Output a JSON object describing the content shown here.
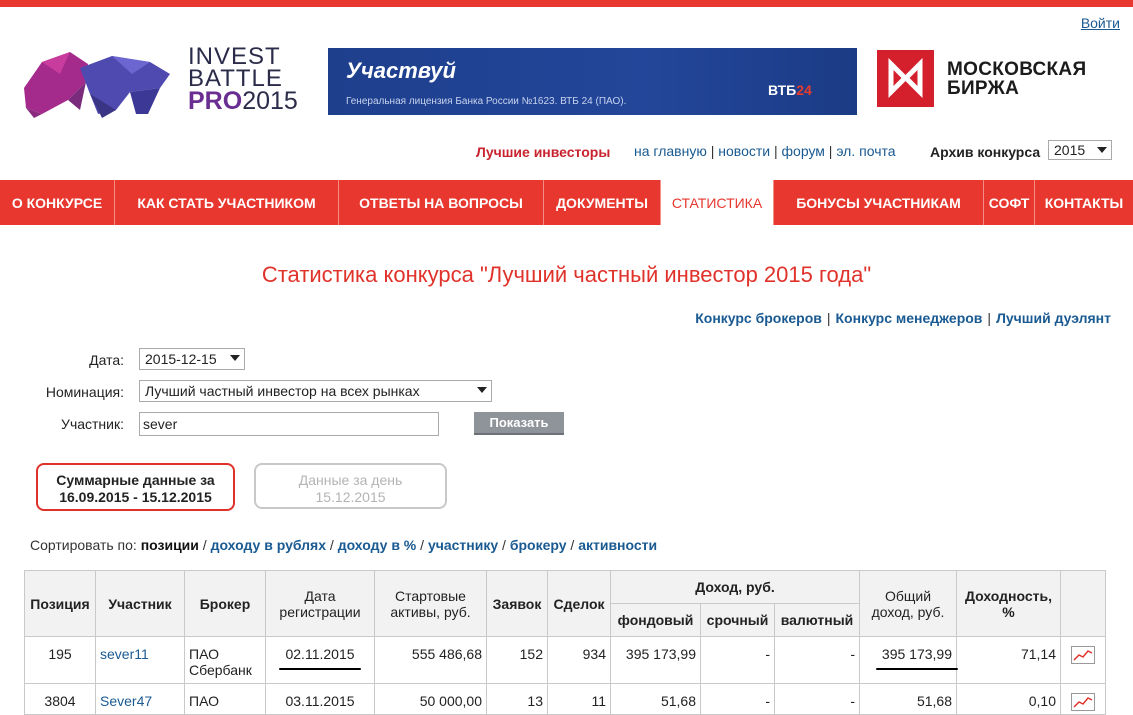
{
  "header": {
    "login": "Войти",
    "logo": {
      "line1": "INVEST",
      "line2": "BATTLE",
      "line3_brand": "PRO",
      "line3_year": "2015"
    },
    "banner": {
      "title": "Участвуй",
      "subtitle": "Генеральная лицензия Банка России №1623. ВТБ 24 (ПАО).",
      "brand_a": "ВТБ",
      "brand_b": "24"
    },
    "moex": {
      "line1": "МОСКОВСКАЯ",
      "line2": "БИРЖА"
    }
  },
  "subnav": {
    "best_investors": "Лучшие инвесторы",
    "links": [
      "на главную",
      "новости",
      "форум",
      "эл. почта"
    ],
    "archive_label": "Архив конкурса",
    "archive_year": "2015"
  },
  "menu": [
    {
      "label": "О КОНКУРСЕ",
      "active": false
    },
    {
      "label": "КАК СТАТЬ УЧАСТНИКОМ",
      "active": false
    },
    {
      "label": "ОТВЕТЫ НА ВОПРОСЫ",
      "active": false
    },
    {
      "label": "ДОКУМЕНТЫ",
      "active": false
    },
    {
      "label": "СТАТИСТИКА",
      "active": true
    },
    {
      "label": "БОНУСЫ УЧАСТНИКАМ",
      "active": false
    },
    {
      "label": "СОФТ",
      "active": false
    },
    {
      "label": "КОНТАКТЫ",
      "active": false
    }
  ],
  "page": {
    "title": "Статистика конкурса \"Лучший частный инвестор 2015 года\"",
    "contest_links": [
      "Конкурс брокеров",
      "Конкурс менеджеров",
      "Лучший дуэлянт"
    ]
  },
  "filters": {
    "date_label": "Дата:",
    "date_value": "2015-12-15",
    "nomination_label": "Номинация:",
    "nomination_value": "Лучший частный инвестор на всех рынках",
    "participant_label": "Участник:",
    "participant_value": "sever",
    "show_button": "Показать"
  },
  "tabs": {
    "summary_line1": "Суммарные данные за",
    "summary_line2": "16.09.2015 - 15.12.2015",
    "day_line1": "Данные за день",
    "day_line2": "15.12.2015"
  },
  "sort": {
    "label": "Сортировать по:",
    "current": "позиции",
    "links": [
      "доходу в рублях",
      "доходу в %",
      "участнику",
      "брокеру",
      "активности"
    ]
  },
  "table": {
    "headers": {
      "position": "Позиция",
      "participant": "Участник",
      "broker": "Брокер",
      "reg_date_1": "Дата",
      "reg_date_2": "регистрации",
      "start_assets_1": "Стартовые",
      "start_assets_2": "активы, руб.",
      "orders": "Заявок",
      "deals": "Сделок",
      "income_group": "Доход, руб.",
      "income_stock": "фондовый",
      "income_futures": "срочный",
      "income_fx": "валютный",
      "total_income_1": "Общий",
      "total_income_2": "доход, руб.",
      "yield_1": "Доходность,",
      "yield_2": "%"
    },
    "rows": [
      {
        "position": "195",
        "participant": "sever11",
        "broker_1": "ПАО",
        "broker_2": "Сбербанк",
        "reg_date": "02.11.2015",
        "start_assets": "555 486,68",
        "orders": "152",
        "deals": "934",
        "stock": "395 173,99",
        "futures": "-",
        "fx": "-",
        "total": "395 173,99",
        "yield": "71,14"
      },
      {
        "position": "3804",
        "participant": "Sever47",
        "broker_1": "ПАО",
        "broker_2": "",
        "reg_date": "03.11.2015",
        "start_assets": "50 000,00",
        "orders": "13",
        "deals": "11",
        "stock": "51,68",
        "futures": "-",
        "fx": "-",
        "total": "51,68",
        "yield": "0,10"
      }
    ]
  },
  "colors": {
    "accent": "#e8372e",
    "link": "#1a5a92",
    "title": "#e0322a"
  }
}
